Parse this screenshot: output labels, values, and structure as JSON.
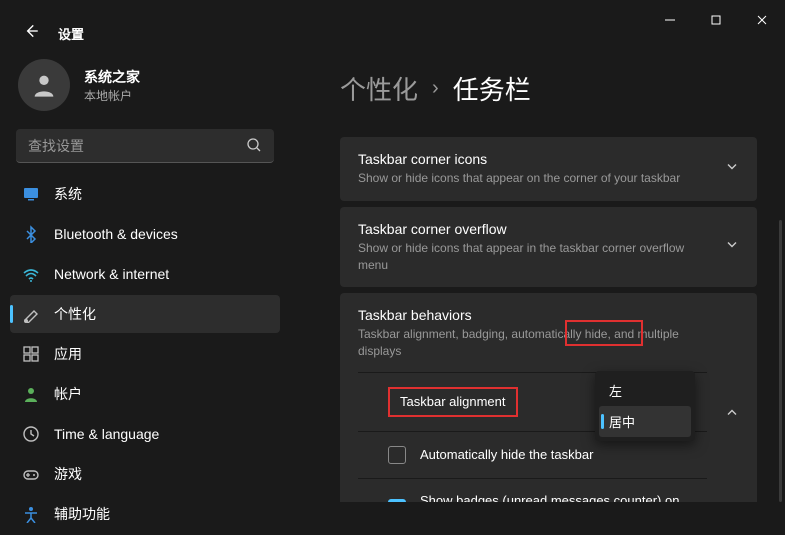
{
  "window": {
    "app_title": "设置"
  },
  "user": {
    "name": "系统之家",
    "sub": "本地帐户"
  },
  "search": {
    "placeholder": "查找设置"
  },
  "nav": [
    {
      "label": "系统",
      "icon": "monitor",
      "color": "#3b8fe0"
    },
    {
      "label": "Bluetooth & devices",
      "icon": "bluetooth",
      "color": "#3b8fe0"
    },
    {
      "label": "Network & internet",
      "icon": "wifi",
      "color": "#3ab7d8"
    },
    {
      "label": "个性化",
      "icon": "brush",
      "color": "#c0c0c0",
      "active": true
    },
    {
      "label": "应用",
      "icon": "grid",
      "color": "#c0c0c0"
    },
    {
      "label": "帐户",
      "icon": "person",
      "color": "#5bb05b"
    },
    {
      "label": "Time & language",
      "icon": "clock",
      "color": "#c0c0c0"
    },
    {
      "label": "游戏",
      "icon": "gamepad",
      "color": "#c0c0c0"
    },
    {
      "label": "辅助功能",
      "icon": "accessibility",
      "color": "#3b8fe0"
    }
  ],
  "breadcrumb": {
    "parent": "个性化",
    "current": "任务栏"
  },
  "cards": [
    {
      "title": "Taskbar corner icons",
      "sub": "Show or hide icons that appear on the corner of your taskbar",
      "expanded": false
    },
    {
      "title": "Taskbar corner overflow",
      "sub": "Show or hide icons that appear in the taskbar corner overflow menu",
      "expanded": false
    },
    {
      "title": "Taskbar behaviors",
      "sub": "Taskbar alignment, badging, automatically hide, and multiple displays",
      "expanded": true,
      "alignment_label": "Taskbar alignment",
      "alignment_options": [
        "左",
        "居中"
      ],
      "alignment_selected": "居中",
      "checkbox1_label": "Automatically hide the taskbar",
      "checkbox1_checked": false,
      "checkbox2_label": "Show badges (unread messages counter) on taskbar apps",
      "checkbox2_checked": true
    }
  ]
}
